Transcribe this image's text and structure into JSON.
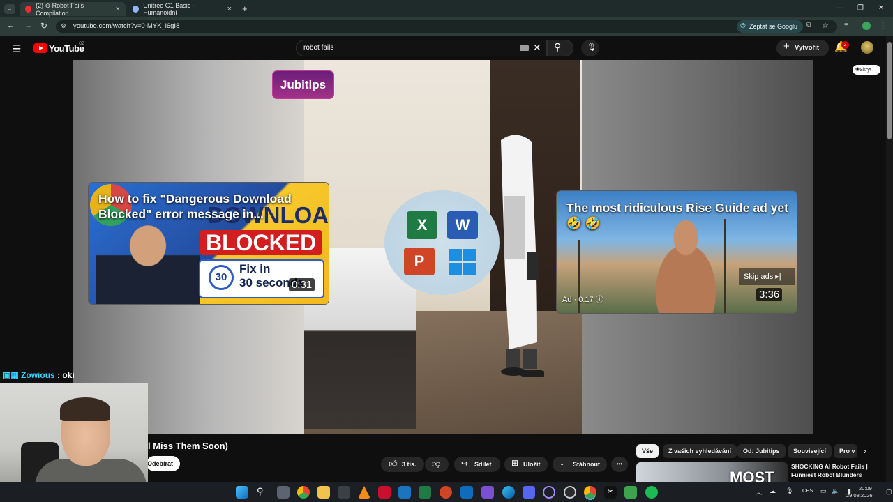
{
  "browser": {
    "tabs": [
      {
        "label": "(2) ⊖ Robot Fails Compilation",
        "active": true
      },
      {
        "label": "Unitree G1 Basic - Humanoidní",
        "active": false
      }
    ],
    "new_tab": "+",
    "url": "youtube.com/watch?v=0-MYK_i6gI8",
    "ask_google": "Zeptat se Googlu",
    "window_controls": [
      "—",
      "❐",
      "✕"
    ]
  },
  "youtube": {
    "logo": "YouTube",
    "region": "CZ",
    "search_value": "robot fails",
    "create_label": "Vytvořit",
    "notifications_count": "2",
    "hide_label": "Skrýt"
  },
  "video": {
    "brand_sticker": "Jubitips",
    "card1": {
      "title": "How to fix \"Dangerous Download Blocked\" error message in...",
      "thumb_top": "DOWNLOAD",
      "thumb_mid": "BLOCKED",
      "thumb_clock": "30",
      "thumb_fix1": "Fix in",
      "thumb_fix2": "30 seconds",
      "duration": "0:31"
    },
    "card2": {
      "title": "The most ridiculous Rise Guide ad yet 🤣 🤣",
      "skip_ads": "Skip ads ▸|",
      "ad_label": "Ad · 0:17 ⓘ",
      "duration": "3:36"
    },
    "office_letters": [
      "X",
      "W",
      "P"
    ]
  },
  "chat": {
    "name": "Zowious",
    "message": ": oki"
  },
  "below": {
    "title_fragment": "l Miss Them Soon)",
    "subscribe": "Odebírat",
    "likes": "3 tis.",
    "share": "Sdílet",
    "save": "Uložit",
    "download": "Stáhnout",
    "more": "•••"
  },
  "chips": [
    "Vše",
    "Z vašich vyhledávání",
    "Od: Jubitips",
    "Související",
    "Pro v"
  ],
  "recommendation": {
    "thumb_text": "MOST",
    "title": "SHOCKING AI Robot Fails | Funniest Robot Blunders"
  },
  "taskbar": {
    "lang": "CES",
    "time": "20:09",
    "date": "29.08.2026"
  },
  "colors": {
    "accent": "#ff0000",
    "chat_name": "#2fd4ff",
    "sticker": "#a33188"
  }
}
